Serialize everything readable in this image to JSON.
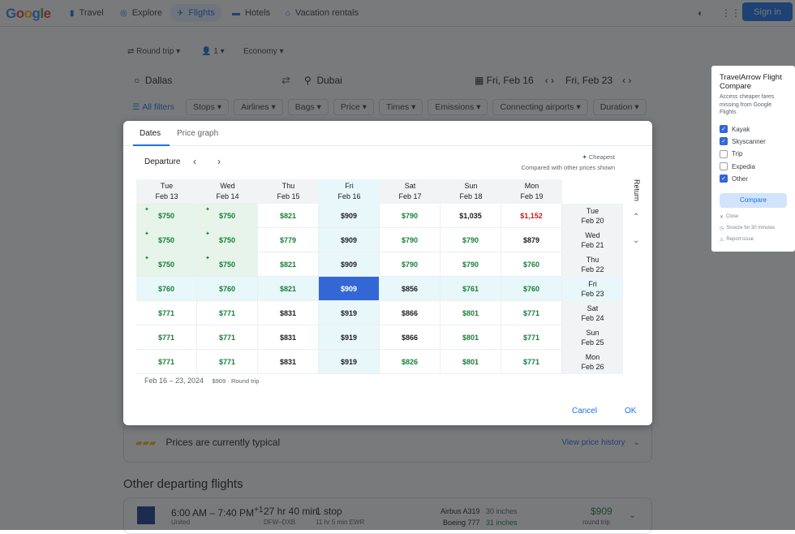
{
  "header": {
    "logo": [
      "G",
      "o",
      "o",
      "g",
      "l",
      "e"
    ],
    "nav": [
      {
        "label": "Travel",
        "icon": "travel-icon"
      },
      {
        "label": "Explore",
        "icon": "explore-icon"
      },
      {
        "label": "Flights",
        "icon": "flight-icon"
      },
      {
        "label": "Hotels",
        "icon": "hotel-icon"
      },
      {
        "label": "Vacation rentals",
        "icon": "house-icon"
      }
    ],
    "sign_in": "Sign in"
  },
  "search": {
    "trip_type": "Round trip",
    "passengers": "1",
    "cabin": "Economy",
    "origin": "Dallas",
    "destination": "Dubai",
    "depart_date": "Fri, Feb 16",
    "return_date": "Fri, Feb 23"
  },
  "filters": [
    "All filters",
    "Stops",
    "Airlines",
    "Bags",
    "Price",
    "Times",
    "Emissions",
    "Connecting airports",
    "Duration"
  ],
  "price_insight": {
    "text": "Prices are currently typical",
    "link": "View price history"
  },
  "other_flights": {
    "title": "Other departing flights",
    "items": [
      {
        "times": "6:00 AM – 7:40 PM",
        "plus": "+1",
        "airline": "United",
        "duration": "27 hr 40 min",
        "route": "DFW–DXB",
        "stops": "1 stop",
        "layover": "11 hr 5 min EWR",
        "aircraft1": "Airbus A319",
        "legroom1": "30 inches",
        "aircraft2": "Boeing 777",
        "legroom2": "31 inches",
        "price": "$909",
        "price_note": "round trip"
      }
    ]
  },
  "extension": {
    "title": "TravelArrow Flight Compare",
    "subtitle": "Access cheaper fares missing from Google Flights",
    "options": [
      {
        "label": "Kayak",
        "checked": true
      },
      {
        "label": "Skyscanner",
        "checked": true
      },
      {
        "label": "Trip",
        "checked": false
      },
      {
        "label": "Expedia",
        "checked": false
      },
      {
        "label": "Other",
        "checked": true
      }
    ],
    "compare": "Compare",
    "close": "Close",
    "snooze": "Snooze for 30 minutes",
    "report": "Report issue"
  },
  "modal": {
    "tabs": [
      "Dates",
      "Price graph"
    ],
    "departure_label": "Departure",
    "return_label": "Return",
    "legend_cheapest": "Cheapest",
    "legend_note": "Compared with other prices shown",
    "departure_dates": [
      {
        "dow": "Tue",
        "date": "Feb 13"
      },
      {
        "dow": "Wed",
        "date": "Feb 14"
      },
      {
        "dow": "Thu",
        "date": "Feb 15"
      },
      {
        "dow": "Fri",
        "date": "Feb 16"
      },
      {
        "dow": "Sat",
        "date": "Feb 17"
      },
      {
        "dow": "Sun",
        "date": "Feb 18"
      },
      {
        "dow": "Mon",
        "date": "Feb 19"
      }
    ],
    "return_dates": [
      {
        "dow": "Tue",
        "date": "Feb 20"
      },
      {
        "dow": "Wed",
        "date": "Feb 21"
      },
      {
        "dow": "Thu",
        "date": "Feb 22"
      },
      {
        "dow": "Fri",
        "date": "Feb 23"
      },
      {
        "dow": "Sat",
        "date": "Feb 24"
      },
      {
        "dow": "Sun",
        "date": "Feb 25"
      },
      {
        "dow": "Mon",
        "date": "Feb 26"
      }
    ],
    "prices": [
      [
        {
          "p": "$750",
          "c": "green",
          "cheap": true
        },
        {
          "p": "$750",
          "c": "green",
          "cheap": true
        },
        {
          "p": "$821",
          "c": "green"
        },
        {
          "p": "$909",
          "c": "black"
        },
        {
          "p": "$790",
          "c": "green"
        },
        {
          "p": "$1,035",
          "c": "black"
        },
        {
          "p": "$1,152",
          "c": "red"
        }
      ],
      [
        {
          "p": "$750",
          "c": "green",
          "cheap": true
        },
        {
          "p": "$750",
          "c": "green",
          "cheap": true
        },
        {
          "p": "$779",
          "c": "green"
        },
        {
          "p": "$909",
          "c": "black"
        },
        {
          "p": "$790",
          "c": "green"
        },
        {
          "p": "$790",
          "c": "green"
        },
        {
          "p": "$879",
          "c": "black"
        }
      ],
      [
        {
          "p": "$750",
          "c": "green",
          "cheap": true
        },
        {
          "p": "$750",
          "c": "green",
          "cheap": true
        },
        {
          "p": "$821",
          "c": "green"
        },
        {
          "p": "$909",
          "c": "black"
        },
        {
          "p": "$790",
          "c": "green"
        },
        {
          "p": "$790",
          "c": "green"
        },
        {
          "p": "$760",
          "c": "green"
        }
      ],
      [
        {
          "p": "$760",
          "c": "green"
        },
        {
          "p": "$760",
          "c": "green"
        },
        {
          "p": "$821",
          "c": "green"
        },
        {
          "p": "$909",
          "c": "black",
          "picked": true
        },
        {
          "p": "$856",
          "c": "black"
        },
        {
          "p": "$761",
          "c": "green"
        },
        {
          "p": "$760",
          "c": "green"
        }
      ],
      [
        {
          "p": "$771",
          "c": "green"
        },
        {
          "p": "$771",
          "c": "green"
        },
        {
          "p": "$831",
          "c": "black"
        },
        {
          "p": "$919",
          "c": "black"
        },
        {
          "p": "$866",
          "c": "black"
        },
        {
          "p": "$801",
          "c": "green"
        },
        {
          "p": "$771",
          "c": "green"
        }
      ],
      [
        {
          "p": "$771",
          "c": "green"
        },
        {
          "p": "$771",
          "c": "green"
        },
        {
          "p": "$831",
          "c": "black"
        },
        {
          "p": "$919",
          "c": "black"
        },
        {
          "p": "$866",
          "c": "black"
        },
        {
          "p": "$801",
          "c": "green"
        },
        {
          "p": "$771",
          "c": "green"
        }
      ],
      [
        {
          "p": "$771",
          "c": "green"
        },
        {
          "p": "$771",
          "c": "green"
        },
        {
          "p": "$831",
          "c": "black"
        },
        {
          "p": "$919",
          "c": "black"
        },
        {
          "p": "$826",
          "c": "green"
        },
        {
          "p": "$801",
          "c": "green"
        },
        {
          "p": "$771",
          "c": "green"
        }
      ]
    ],
    "selected_departure_index": 3,
    "selected_return_index": 3,
    "summary_dates": "Feb 16 – 23, 2024",
    "summary_price": "$909",
    "summary_type": "· Round trip",
    "cancel": "Cancel",
    "ok": "OK"
  },
  "colors": {
    "accent": "#1a73e8",
    "green": "#188038",
    "red": "#c5221f",
    "selected": "#3367d6"
  }
}
